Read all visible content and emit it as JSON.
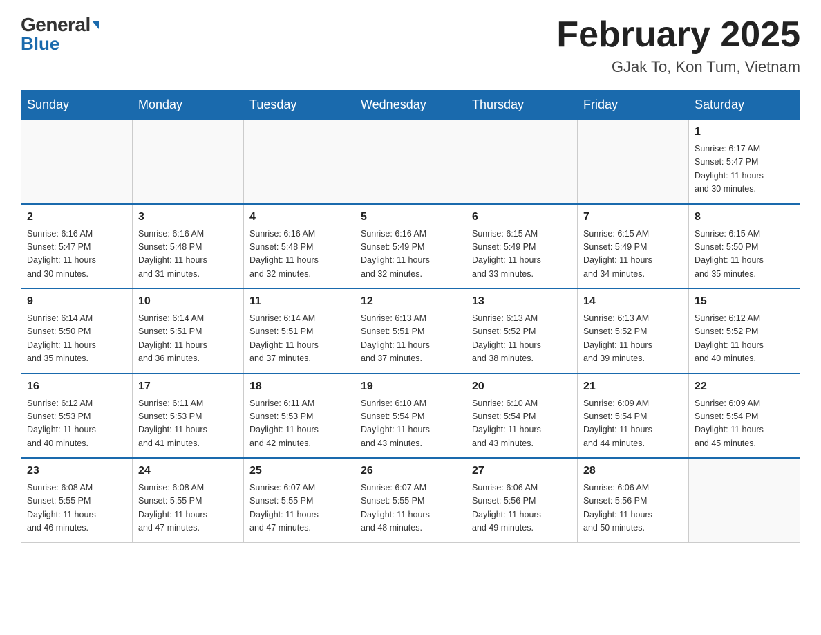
{
  "logo": {
    "general": "General",
    "blue": "Blue"
  },
  "title": "February 2025",
  "location": "GJak To, Kon Tum, Vietnam",
  "days_of_week": [
    "Sunday",
    "Monday",
    "Tuesday",
    "Wednesday",
    "Thursday",
    "Friday",
    "Saturday"
  ],
  "weeks": [
    [
      {
        "day": "",
        "info": ""
      },
      {
        "day": "",
        "info": ""
      },
      {
        "day": "",
        "info": ""
      },
      {
        "day": "",
        "info": ""
      },
      {
        "day": "",
        "info": ""
      },
      {
        "day": "",
        "info": ""
      },
      {
        "day": "1",
        "info": "Sunrise: 6:17 AM\nSunset: 5:47 PM\nDaylight: 11 hours\nand 30 minutes."
      }
    ],
    [
      {
        "day": "2",
        "info": "Sunrise: 6:16 AM\nSunset: 5:47 PM\nDaylight: 11 hours\nand 30 minutes."
      },
      {
        "day": "3",
        "info": "Sunrise: 6:16 AM\nSunset: 5:48 PM\nDaylight: 11 hours\nand 31 minutes."
      },
      {
        "day": "4",
        "info": "Sunrise: 6:16 AM\nSunset: 5:48 PM\nDaylight: 11 hours\nand 32 minutes."
      },
      {
        "day": "5",
        "info": "Sunrise: 6:16 AM\nSunset: 5:49 PM\nDaylight: 11 hours\nand 32 minutes."
      },
      {
        "day": "6",
        "info": "Sunrise: 6:15 AM\nSunset: 5:49 PM\nDaylight: 11 hours\nand 33 minutes."
      },
      {
        "day": "7",
        "info": "Sunrise: 6:15 AM\nSunset: 5:49 PM\nDaylight: 11 hours\nand 34 minutes."
      },
      {
        "day": "8",
        "info": "Sunrise: 6:15 AM\nSunset: 5:50 PM\nDaylight: 11 hours\nand 35 minutes."
      }
    ],
    [
      {
        "day": "9",
        "info": "Sunrise: 6:14 AM\nSunset: 5:50 PM\nDaylight: 11 hours\nand 35 minutes."
      },
      {
        "day": "10",
        "info": "Sunrise: 6:14 AM\nSunset: 5:51 PM\nDaylight: 11 hours\nand 36 minutes."
      },
      {
        "day": "11",
        "info": "Sunrise: 6:14 AM\nSunset: 5:51 PM\nDaylight: 11 hours\nand 37 minutes."
      },
      {
        "day": "12",
        "info": "Sunrise: 6:13 AM\nSunset: 5:51 PM\nDaylight: 11 hours\nand 37 minutes."
      },
      {
        "day": "13",
        "info": "Sunrise: 6:13 AM\nSunset: 5:52 PM\nDaylight: 11 hours\nand 38 minutes."
      },
      {
        "day": "14",
        "info": "Sunrise: 6:13 AM\nSunset: 5:52 PM\nDaylight: 11 hours\nand 39 minutes."
      },
      {
        "day": "15",
        "info": "Sunrise: 6:12 AM\nSunset: 5:52 PM\nDaylight: 11 hours\nand 40 minutes."
      }
    ],
    [
      {
        "day": "16",
        "info": "Sunrise: 6:12 AM\nSunset: 5:53 PM\nDaylight: 11 hours\nand 40 minutes."
      },
      {
        "day": "17",
        "info": "Sunrise: 6:11 AM\nSunset: 5:53 PM\nDaylight: 11 hours\nand 41 minutes."
      },
      {
        "day": "18",
        "info": "Sunrise: 6:11 AM\nSunset: 5:53 PM\nDaylight: 11 hours\nand 42 minutes."
      },
      {
        "day": "19",
        "info": "Sunrise: 6:10 AM\nSunset: 5:54 PM\nDaylight: 11 hours\nand 43 minutes."
      },
      {
        "day": "20",
        "info": "Sunrise: 6:10 AM\nSunset: 5:54 PM\nDaylight: 11 hours\nand 43 minutes."
      },
      {
        "day": "21",
        "info": "Sunrise: 6:09 AM\nSunset: 5:54 PM\nDaylight: 11 hours\nand 44 minutes."
      },
      {
        "day": "22",
        "info": "Sunrise: 6:09 AM\nSunset: 5:54 PM\nDaylight: 11 hours\nand 45 minutes."
      }
    ],
    [
      {
        "day": "23",
        "info": "Sunrise: 6:08 AM\nSunset: 5:55 PM\nDaylight: 11 hours\nand 46 minutes."
      },
      {
        "day": "24",
        "info": "Sunrise: 6:08 AM\nSunset: 5:55 PM\nDaylight: 11 hours\nand 47 minutes."
      },
      {
        "day": "25",
        "info": "Sunrise: 6:07 AM\nSunset: 5:55 PM\nDaylight: 11 hours\nand 47 minutes."
      },
      {
        "day": "26",
        "info": "Sunrise: 6:07 AM\nSunset: 5:55 PM\nDaylight: 11 hours\nand 48 minutes."
      },
      {
        "day": "27",
        "info": "Sunrise: 6:06 AM\nSunset: 5:56 PM\nDaylight: 11 hours\nand 49 minutes."
      },
      {
        "day": "28",
        "info": "Sunrise: 6:06 AM\nSunset: 5:56 PM\nDaylight: 11 hours\nand 50 minutes."
      },
      {
        "day": "",
        "info": ""
      }
    ]
  ]
}
